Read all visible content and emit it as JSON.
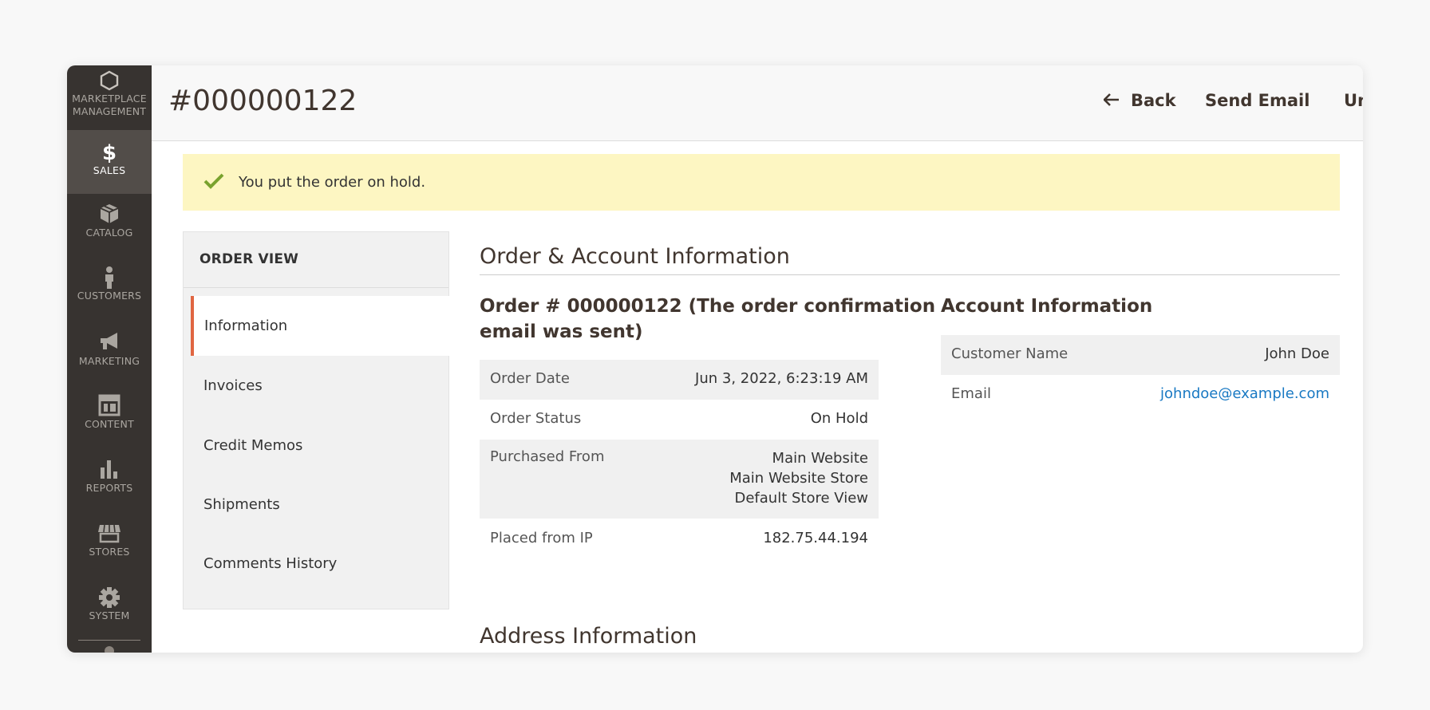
{
  "sidebar": {
    "logo_label_1": "MARKETPLACE",
    "logo_label_2": "MANAGEMENT",
    "items": [
      {
        "label": "SALES",
        "icon": "dollar-icon"
      },
      {
        "label": "CATALOG",
        "icon": "box-icon"
      },
      {
        "label": "CUSTOMERS",
        "icon": "person-icon"
      },
      {
        "label": "MARKETING",
        "icon": "megaphone-icon"
      },
      {
        "label": "CONTENT",
        "icon": "layout-icon"
      },
      {
        "label": "REPORTS",
        "icon": "bar-chart-icon"
      },
      {
        "label": "STORES",
        "icon": "storefront-icon"
      },
      {
        "label": "SYSTEM",
        "icon": "gear-icon"
      }
    ]
  },
  "header": {
    "title": "#000000122",
    "back_label": "Back",
    "send_email_label": "Send Email",
    "unhold_label": "Unhold"
  },
  "message": {
    "text": "You put the order on hold."
  },
  "order_nav": {
    "title": "ORDER VIEW",
    "items": [
      "Information",
      "Invoices",
      "Credit Memos",
      "Shipments",
      "Comments History"
    ]
  },
  "main": {
    "section_title": "Order & Account Information",
    "order_heading_line1": "Order # 000000122 (The order confirmation",
    "order_heading_line2": "email was sent)",
    "order_rows": {
      "order_date_label": "Order Date",
      "order_date_value": "Jun 3, 2022, 6:23:19 AM",
      "order_status_label": "Order Status",
      "order_status_value": "On Hold",
      "purchased_from_label": "Purchased From",
      "purchased_from_lines": [
        "Main Website",
        "Main Website Store",
        "Default Store View"
      ],
      "placed_ip_label": "Placed from IP",
      "placed_ip_value": "182.75.44.194"
    },
    "account_heading": "Account Information",
    "account_rows": {
      "customer_name_label": "Customer Name",
      "customer_name_value": "John Doe",
      "email_label": "Email",
      "email_value": "johndoe@example.com"
    },
    "address_title": "Address Information"
  },
  "colors": {
    "sidebar_bg": "#373330",
    "sidebar_active": "#524d49",
    "accent": "#e06641",
    "notice_bg": "#fdf6c2",
    "success": "#79a22e",
    "link": "#1979c3"
  }
}
